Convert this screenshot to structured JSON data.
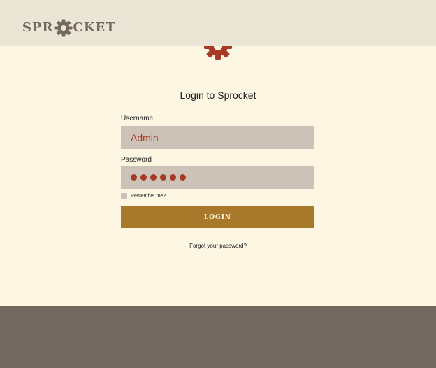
{
  "header": {
    "logo_prefix": "SPR",
    "logo_suffix": "CKET"
  },
  "login": {
    "title": "Login to Sprocket",
    "username_label": "Username",
    "username_value": "Admin",
    "password_label": "Password",
    "password_masked_length": 6,
    "remember_label": "Remember me?",
    "submit_label": "LOGIN",
    "forgot_link": "Forgot your password?"
  },
  "colors": {
    "header_bg": "#ebe5d5",
    "page_bg": "#fdf6e3",
    "footer_bg": "#736961",
    "accent": "#a73a26",
    "button": "#a8792a",
    "field_bg": "#cdc2b8"
  },
  "icons": {
    "logo_gear": "gear-icon",
    "hero_gear": "gear-icon"
  }
}
